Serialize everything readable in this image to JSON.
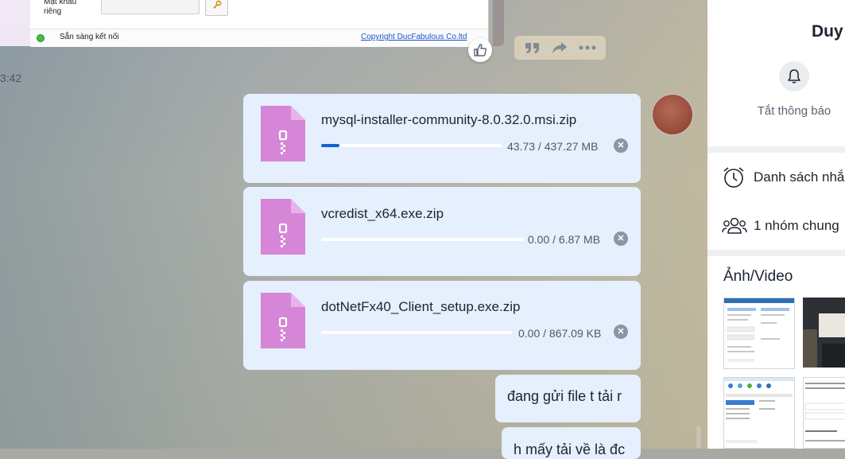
{
  "embedded_window": {
    "password_label": "Mật khẩu riêng",
    "status_text": "Sẵn sàng kết nối",
    "copyright": "Copyright DucFabulous Co.ltd"
  },
  "chat": {
    "timestamp": "3:42",
    "files": [
      {
        "name": "mysql-installer-community-8.0.32.0.msi.zip",
        "size": "43.73 / 437.27 MB",
        "progress": 0.1
      },
      {
        "name": "vcredist_x64.exe.zip",
        "size": "0.00 / 6.87 MB",
        "progress": 0.0
      },
      {
        "name": "dotNetFx40_Client_setup.exe.zip",
        "size": "0.00 / 867.09 KB",
        "progress": 0.0
      }
    ],
    "messages": [
      {
        "text": "đang gửi file t tải r"
      },
      {
        "text": "h mấy tải về là đc"
      }
    ]
  },
  "right_panel": {
    "name": "Duy",
    "mute_label": "Tắt thông báo",
    "reminders": "Danh sách nhắc hẹn",
    "groups": "1 nhóm chung",
    "media_title": "Ảnh/Video"
  },
  "colors": {
    "bubble": "#e5effd",
    "accent": "#0b63d9",
    "zip_icon": "#d586d6"
  },
  "icons": {
    "like": "thumbs-up-icon",
    "quote": "quote-icon",
    "share": "share-icon",
    "more": "more-icon",
    "cancel": "close-circle-icon",
    "bell": "bell-icon",
    "clock": "alarm-clock-icon",
    "group": "group-icon"
  }
}
